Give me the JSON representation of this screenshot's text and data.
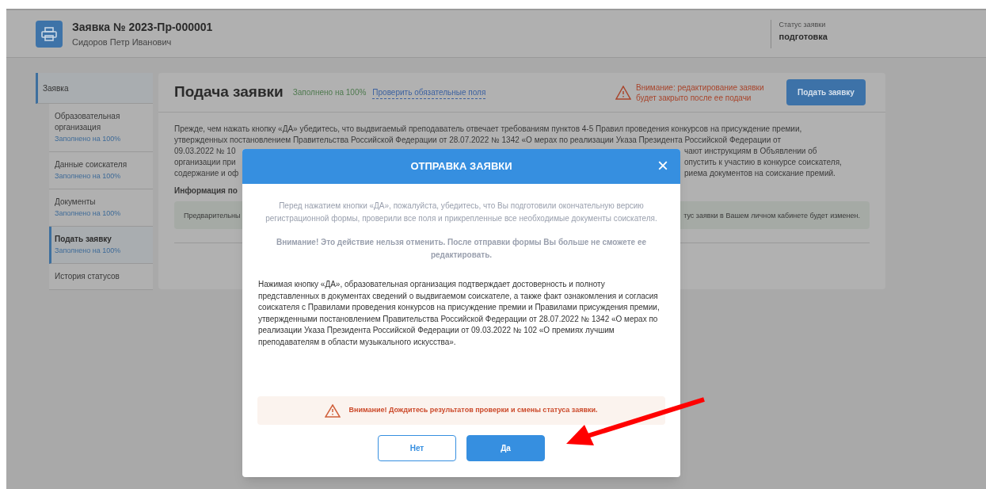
{
  "header": {
    "title": "Заявка № 2023-Пр-000001",
    "subtitle": "Сидоров Петр Иванович",
    "status_label": "Статус заявки",
    "status_value": "подготовка"
  },
  "sidebar": {
    "section": {
      "label": "Заявка",
      "selected": true
    },
    "items": [
      {
        "label": "Образовательная организация",
        "progress": "Заполнено на 100%",
        "selected": false
      },
      {
        "label": "Данные соискателя",
        "progress": "Заполнено на 100%",
        "selected": false
      },
      {
        "label": "Документы",
        "progress": "Заполнено на 100%",
        "selected": false
      },
      {
        "label": "Подать заявку",
        "progress": "Заполнено на 100%",
        "selected": true
      },
      {
        "label": "История статусов",
        "selected": false
      }
    ]
  },
  "main": {
    "title": "Подача заявки",
    "progress": "Заполнено на 100%",
    "check_link": "Проверить обязательные поля",
    "warning": "Внимание: редактирование заявки будет закрыто после ее подачи",
    "submit_button": "Подать заявку",
    "intro_lines": [
      "Прежде, чем нажать кнопку «ДА» убедитесь, что выдвигаемый преподаватель отвечает требованиям пунктов 4-5 Правил проведения конкурсов на присуждение премии,",
      "утвержденных постановлением Правительства Российской Федерации от 28.07.2022 № 1342 «О мерах по реализации Указа Президента Российской Федерации от"
    ],
    "partial_lines": [
      {
        "left": "09.03.2022 № 10",
        "right": "чают инструкциям в Объявлении об"
      },
      {
        "left": "организации при",
        "right": "опустить к участию в конкурсе соискателя,"
      },
      {
        "left": "содержание и оф",
        "right": "риема документов на соискание премий."
      }
    ],
    "info_heading": "Информация по",
    "info_box": {
      "left": "Предварительны",
      "right": "тус заявки в Вашем личном кабинете будет изменен."
    }
  },
  "modal": {
    "title": "ОТПРАВКА ЗАЯВКИ",
    "close": "×",
    "notice": "Перед нажатием кнопки «ДА», пожалуйста, убедитесь, что Вы подготовили окончательную версию регистрационной формы, проверили все поля и прикрепленные все необходимые документы соискателя.",
    "caution": "Внимание! Это действие нельзя отменить. После отправки формы Вы больше не сможете ее редактировать.",
    "body": "Нажимая кнопку «ДА», образовательная организация подтверждает достоверность и полноту представленных в документах сведений о выдвигаемом соискателе, а также факт ознакомления и согласия соискателя с Правилами проведения конкурсов на присуждение премии и Правилами присуждения премии, утвержденными постановлением Правительства Российской Федерации от 28.07.2022 № 1342 «О мерах по реализации Указа Президента Российской Федерации от 09.03.2022 № 102 «О премиях лучшим преподавателям в области музыкального искусства».",
    "alert": "Внимание! Дождитесь результатов проверки и смены статуса заявки.",
    "buttons": [
      {
        "label": "Нет",
        "kind": "secondary"
      },
      {
        "label": "Да",
        "kind": "primary"
      }
    ]
  }
}
